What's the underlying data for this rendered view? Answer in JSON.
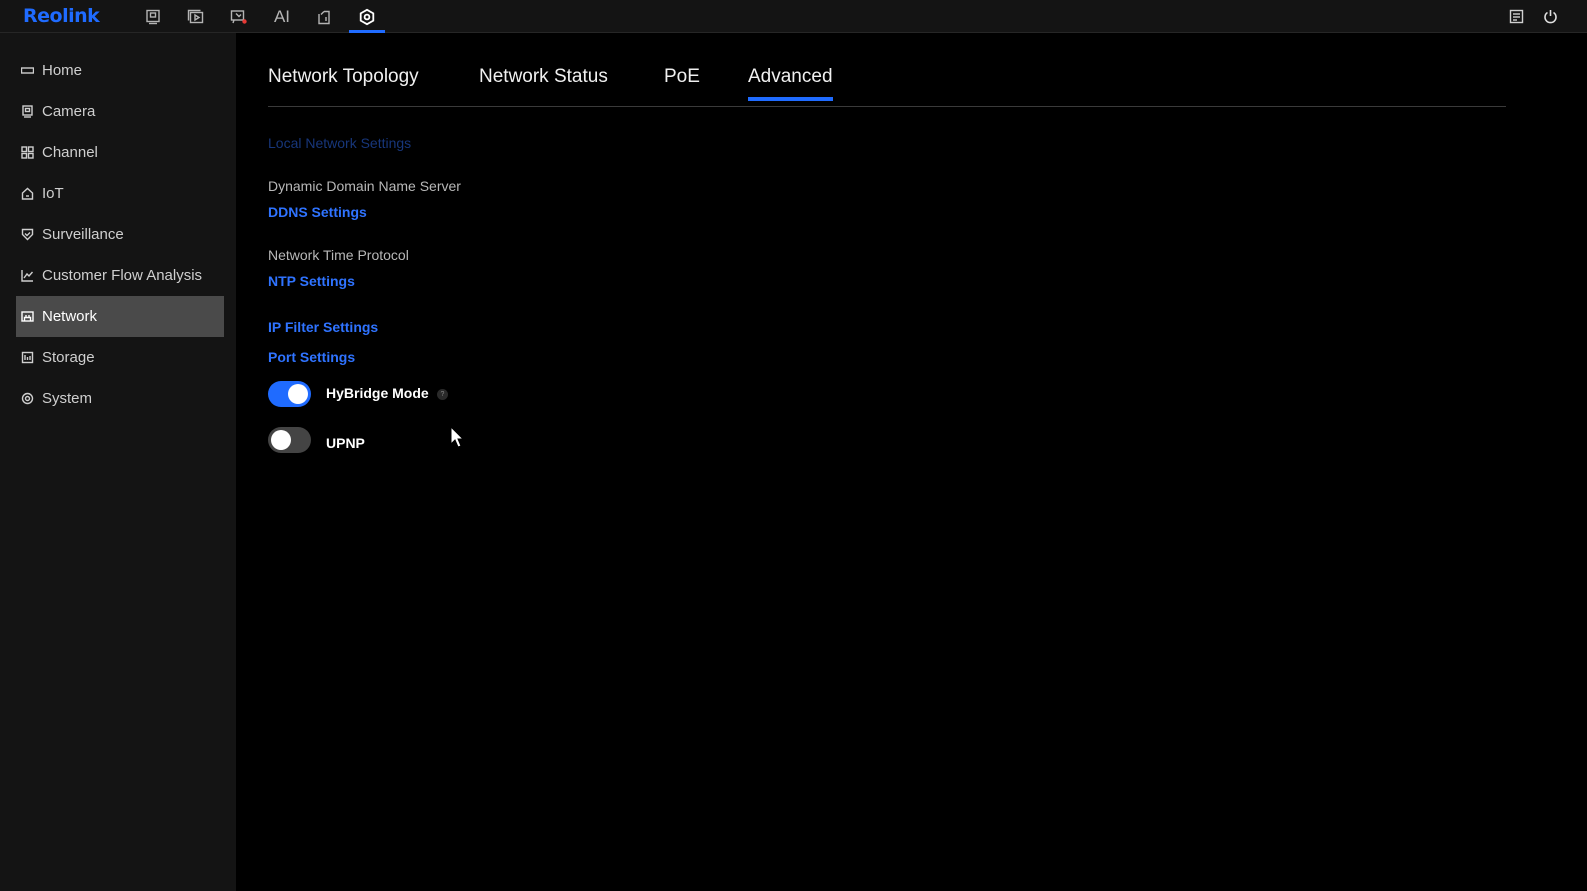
{
  "brand": {
    "logo_text": "Reolink",
    "accent_color": "#1f6bff"
  },
  "topbar": {
    "icons": [
      "preview-icon",
      "playback-icon",
      "alarm-icon",
      "ai-icon",
      "clip-icon",
      "settings-icon"
    ],
    "ai_label": "AI",
    "active": "settings-icon",
    "right_icons": [
      "notes-icon",
      "power-icon"
    ]
  },
  "sidebar": {
    "items": [
      {
        "label": "Home",
        "icon": "home-icon"
      },
      {
        "label": "Camera",
        "icon": "camera-icon"
      },
      {
        "label": "Channel",
        "icon": "channel-icon"
      },
      {
        "label": "IoT",
        "icon": "iot-icon"
      },
      {
        "label": "Surveillance",
        "icon": "shield-icon"
      },
      {
        "label": "Customer Flow Analysis",
        "icon": "chart-icon"
      },
      {
        "label": "Network",
        "icon": "network-icon"
      },
      {
        "label": "Storage",
        "icon": "storage-icon"
      },
      {
        "label": "System",
        "icon": "system-icon"
      }
    ],
    "active_item": "Network"
  },
  "tabs": [
    {
      "label": "Network Topology"
    },
    {
      "label": "Network Status"
    },
    {
      "label": "PoE"
    },
    {
      "label": "Advanced"
    }
  ],
  "active_tab": "Advanced",
  "advanced": {
    "local_network_settings": "Local Network Settings",
    "ddns_section_label": "Dynamic Domain Name Server",
    "ddns_link": "DDNS Settings",
    "ntp_section_label": "Network Time Protocol",
    "ntp_link": "NTP Settings",
    "ip_filter_link": "IP Filter Settings",
    "port_link": "Port Settings",
    "hybridge_label": "HyBridge Mode",
    "hybridge_on": true,
    "help_glyph": "?",
    "upnp_label": "UPNP",
    "upnp_on": false
  }
}
